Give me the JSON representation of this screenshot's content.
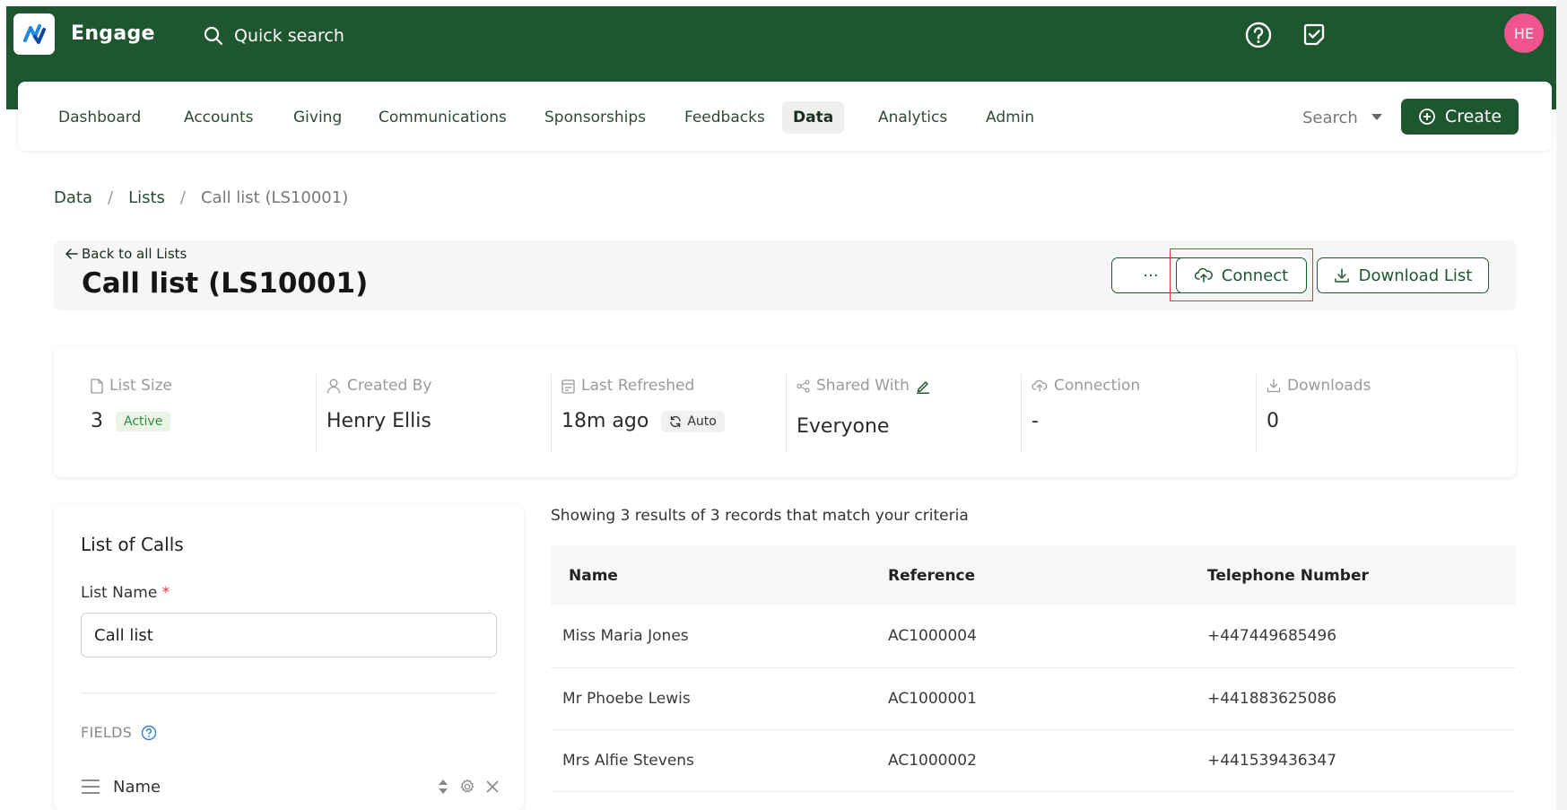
{
  "app": {
    "name": "Engage"
  },
  "search": {
    "placeholder": "Quick search"
  },
  "user": {
    "initials": "HE"
  },
  "nav": {
    "items": [
      "Dashboard",
      "Accounts",
      "Giving",
      "Communications",
      "Sponsorships",
      "Feedbacks",
      "Data",
      "Analytics",
      "Admin"
    ],
    "active": "Data",
    "search_label": "Search",
    "create_label": "Create"
  },
  "breadcrumb": [
    "Data",
    "Lists",
    "Call list (LS10001)"
  ],
  "header": {
    "back_label": "Back to all Lists",
    "title": "Call list (LS10001)",
    "more_label": "···",
    "connect_label": "Connect",
    "download_label": "Download List"
  },
  "stats": {
    "list_size_label": "List Size",
    "list_size_value": "3",
    "list_status": "Active",
    "created_by_label": "Created By",
    "created_by_value": "Henry Ellis",
    "last_refreshed_label": "Last Refreshed",
    "last_refreshed_value": "18m ago",
    "refresh_mode": "Auto",
    "shared_with_label": "Shared With",
    "shared_with_value": "Everyone",
    "connection_label": "Connection",
    "connection_value": "-",
    "downloads_label": "Downloads",
    "downloads_value": "0"
  },
  "panel": {
    "title": "List of Calls",
    "list_name_label": "List Name",
    "required_mark": "*",
    "list_name_value": "Call list",
    "fields_label": "FIELDS",
    "fields": [
      "Name"
    ]
  },
  "results": {
    "summary": "Showing 3 results of 3 records that match your criteria",
    "columns": [
      "Name",
      "Reference",
      "Telephone Number"
    ],
    "rows": [
      [
        "Miss Maria Jones",
        "AC1000004",
        "+447449685496"
      ],
      [
        "Mr Phoebe Lewis",
        "AC1000001",
        "+441883625086"
      ],
      [
        "Mrs Alfie Stevens",
        "AC1000002",
        "+441539436347"
      ]
    ]
  },
  "colors": {
    "brand_green": "#1e5630",
    "avatar_pink": "#f0568d",
    "highlight_red": "#e0343a",
    "active_green": "#2e8b3d"
  }
}
